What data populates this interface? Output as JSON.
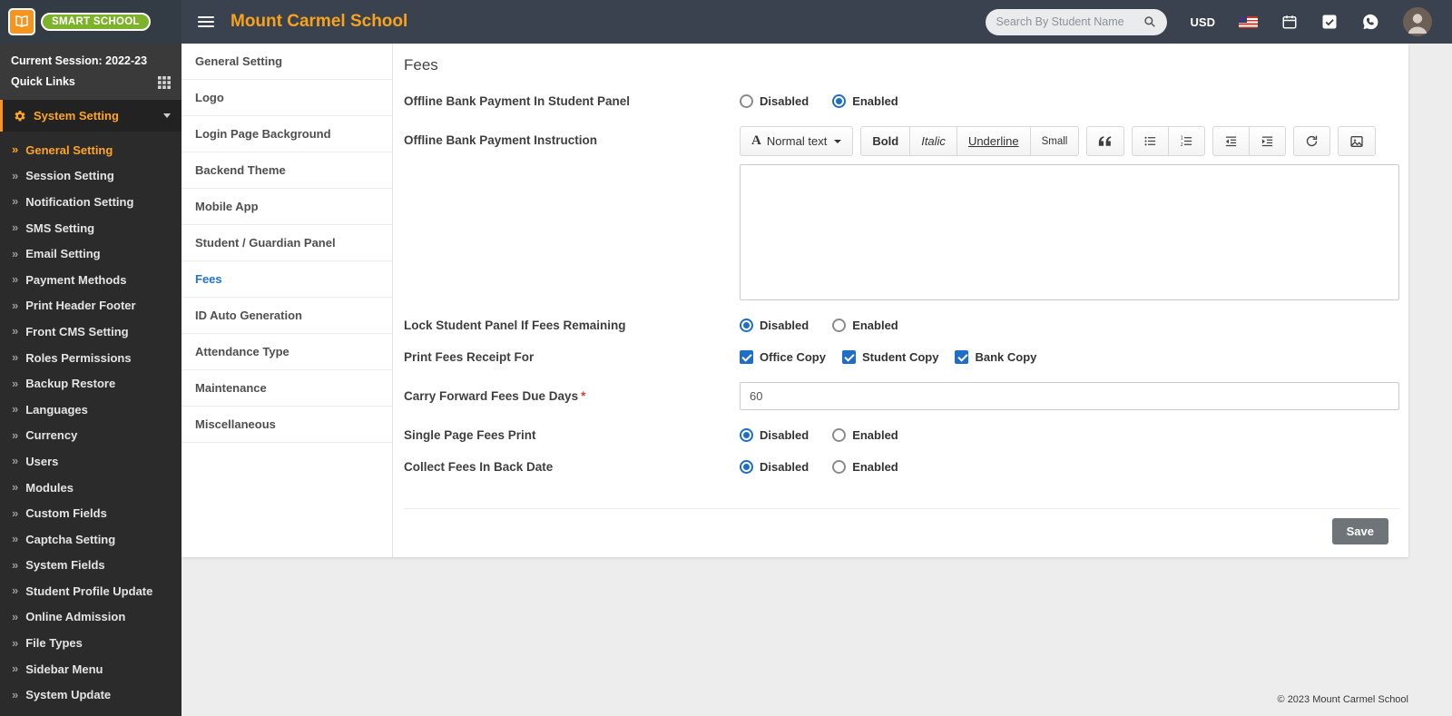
{
  "topbar": {
    "brand": "SMART SCHOOL",
    "school": "Mount Carmel School",
    "search_placeholder": "Search By Student Name",
    "currency": "USD"
  },
  "sidebar": {
    "session": "Current Session: 2022-23",
    "quick_links": "Quick Links",
    "section": "System Setting",
    "items": [
      {
        "label": "General Setting",
        "active": true
      },
      {
        "label": "Session Setting",
        "active": false
      },
      {
        "label": "Notification Setting",
        "active": false
      },
      {
        "label": "SMS Setting",
        "active": false
      },
      {
        "label": "Email Setting",
        "active": false
      },
      {
        "label": "Payment Methods",
        "active": false
      },
      {
        "label": "Print Header Footer",
        "active": false
      },
      {
        "label": "Front CMS Setting",
        "active": false
      },
      {
        "label": "Roles Permissions",
        "active": false
      },
      {
        "label": "Backup Restore",
        "active": false
      },
      {
        "label": "Languages",
        "active": false
      },
      {
        "label": "Currency",
        "active": false
      },
      {
        "label": "Users",
        "active": false
      },
      {
        "label": "Modules",
        "active": false
      },
      {
        "label": "Custom Fields",
        "active": false
      },
      {
        "label": "Captcha Setting",
        "active": false
      },
      {
        "label": "System Fields",
        "active": false
      },
      {
        "label": "Student Profile Update",
        "active": false
      },
      {
        "label": "Online Admission",
        "active": false
      },
      {
        "label": "File Types",
        "active": false
      },
      {
        "label": "Sidebar Menu",
        "active": false
      },
      {
        "label": "System Update",
        "active": false
      }
    ]
  },
  "subnav": {
    "items": [
      {
        "label": "General Setting",
        "active": false
      },
      {
        "label": "Logo",
        "active": false
      },
      {
        "label": "Login Page Background",
        "active": false
      },
      {
        "label": "Backend Theme",
        "active": false
      },
      {
        "label": "Mobile App",
        "active": false
      },
      {
        "label": "Student / Guardian Panel",
        "active": false
      },
      {
        "label": "Fees",
        "active": true
      },
      {
        "label": "ID Auto Generation",
        "active": false
      },
      {
        "label": "Attendance Type",
        "active": false
      },
      {
        "label": "Maintenance",
        "active": false
      },
      {
        "label": "Miscellaneous",
        "active": false
      }
    ]
  },
  "page": {
    "title": "Fees"
  },
  "editor": {
    "style_icon": "A",
    "style_label": "Normal text",
    "bold": "Bold",
    "italic": "Italic",
    "underline": "Underline",
    "small": "Small",
    "icon_buttons": [
      "quote",
      "unordered-list",
      "ordered-list",
      "outdent",
      "indent",
      "redo",
      "image"
    ],
    "content": ""
  },
  "form": {
    "offline_bank_payment": {
      "label": "Offline Bank Payment In Student Panel",
      "options": [
        {
          "label": "Disabled",
          "checked": false
        },
        {
          "label": "Enabled",
          "checked": true
        }
      ]
    },
    "offline_instruction": {
      "label": "Offline Bank Payment Instruction",
      "content": ""
    },
    "lock_student_panel": {
      "label": "Lock Student Panel If Fees Remaining",
      "options": [
        {
          "label": "Disabled",
          "checked": true
        },
        {
          "label": "Enabled",
          "checked": false
        }
      ]
    },
    "print_receipt": {
      "label": "Print Fees Receipt For",
      "options": [
        {
          "label": "Office Copy",
          "checked": true
        },
        {
          "label": "Student Copy",
          "checked": true
        },
        {
          "label": "Bank Copy",
          "checked": true
        }
      ]
    },
    "carry_forward": {
      "label": "Carry Forward Fees Due Days",
      "required_mark": "*",
      "value": "60"
    },
    "single_page": {
      "label": "Single Page Fees Print",
      "options": [
        {
          "label": "Disabled",
          "checked": true
        },
        {
          "label": "Enabled",
          "checked": false
        }
      ]
    },
    "collect_back_date": {
      "label": "Collect Fees In Back Date",
      "options": [
        {
          "label": "Disabled",
          "checked": true
        },
        {
          "label": "Enabled",
          "checked": false
        }
      ]
    },
    "save_label": "Save"
  },
  "footer": {
    "copyright": "© 2023 Mount Carmel School"
  },
  "colors": {
    "topbar_bg": "#39424e",
    "sidebar_bg": "#2b2b2b",
    "accent_orange": "#f9a21b",
    "brand_green": "#7cb32a",
    "active_blue": "#2471c8",
    "control_blue": "#1e6ec8",
    "save_gray": "#6e7478"
  }
}
